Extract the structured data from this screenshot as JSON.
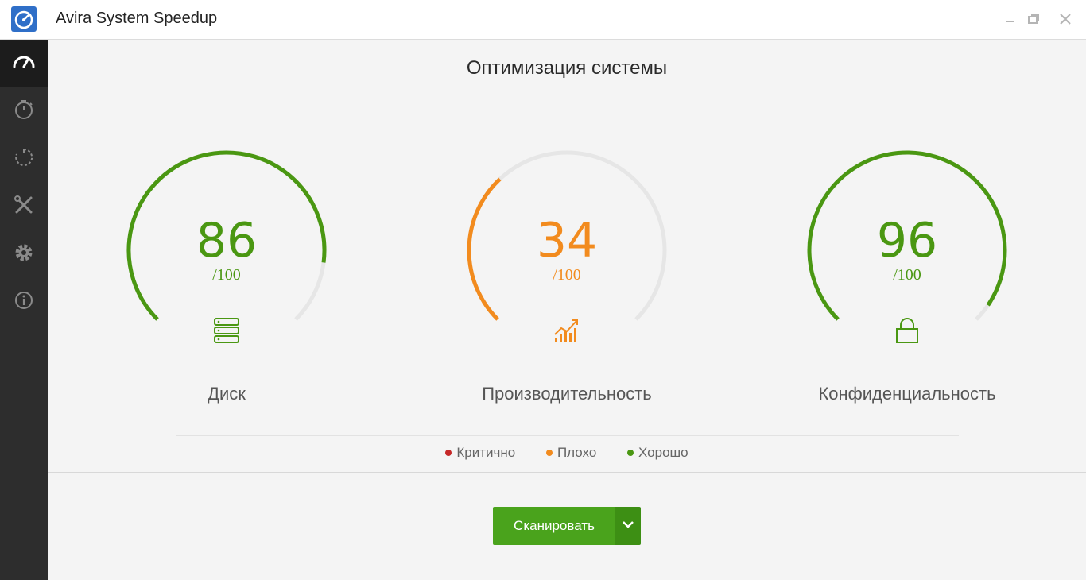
{
  "window": {
    "title": "Avira System Speedup",
    "logo_icon": "speedometer-logo-icon",
    "controls": [
      "minimize-icon",
      "restore-icon",
      "close-icon"
    ]
  },
  "sidebar": {
    "items": [
      {
        "icon": "speedometer-icon",
        "active": true
      },
      {
        "icon": "stopwatch-icon",
        "active": false
      },
      {
        "icon": "power-startup-icon",
        "active": false
      },
      {
        "icon": "tools-icon",
        "active": false
      },
      {
        "icon": "gear-icon",
        "active": false
      },
      {
        "icon": "info-icon",
        "active": false
      }
    ]
  },
  "main": {
    "title": "Оптимизация системы",
    "gauges": [
      {
        "score": "86",
        "max": "/100",
        "label": "Диск",
        "value": 86,
        "color": "#4a9712",
        "icon": "server-stack-icon"
      },
      {
        "score": "34",
        "max": "/100",
        "label": "Производительность",
        "value": 34,
        "color": "#f28b1e",
        "icon": "performance-chart-icon"
      },
      {
        "score": "96",
        "max": "/100",
        "label": "Конфиденциальность",
        "value": 96,
        "color": "#4a9712",
        "icon": "lock-icon"
      }
    ],
    "legend": [
      {
        "label": "Критично",
        "color": "#c62828"
      },
      {
        "label": "Плохо",
        "color": "#f28b1e"
      },
      {
        "label": "Хорошо",
        "color": "#4a9712"
      }
    ],
    "scan": {
      "label": "Сканировать",
      "color": "#4aa31c"
    }
  },
  "colors": {
    "sidebar": "#2d2d2d",
    "track": "#e6e6e6"
  }
}
